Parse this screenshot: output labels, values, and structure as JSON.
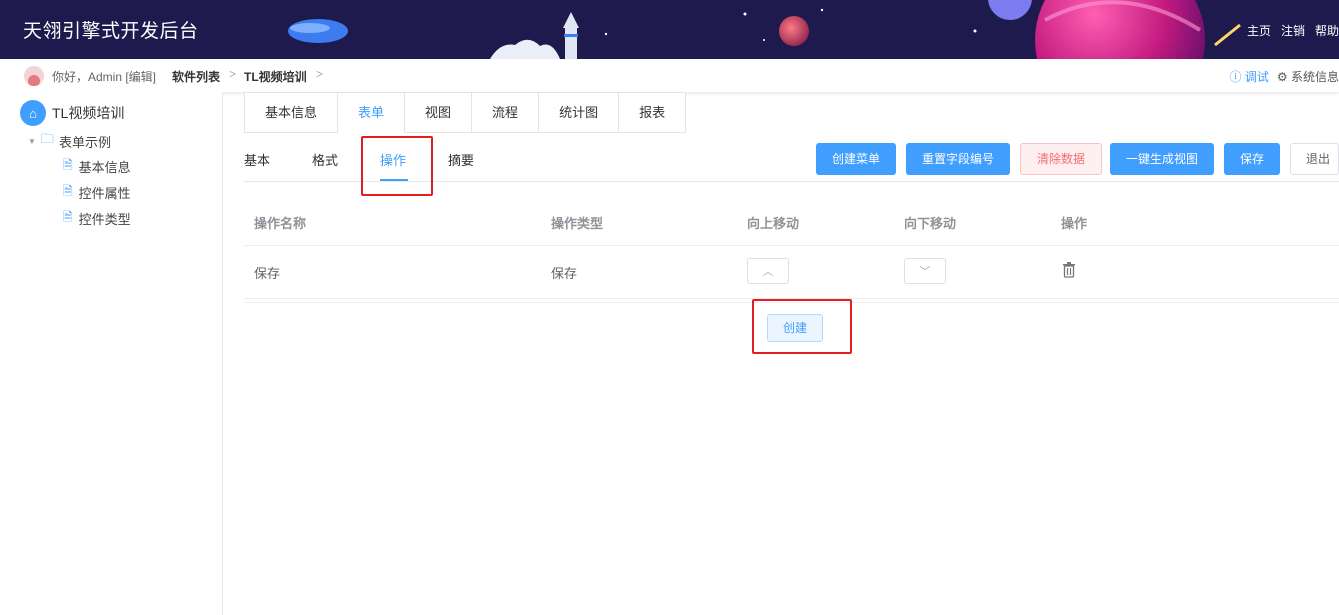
{
  "header": {
    "app_title": "天翎引擎式开发后台",
    "links": [
      "主页",
      "注销",
      "帮助"
    ]
  },
  "breadcrumb": {
    "greeting": "你好，Admin [编辑]",
    "items": [
      "软件列表",
      "TL视频培训"
    ],
    "separator": ">",
    "debug_label": "调试",
    "sysinfo_label": "系统信息"
  },
  "sidebar": {
    "root_label": "TL视频培训",
    "group_label": "表单示例",
    "items": [
      "基本信息",
      "控件属性",
      "控件类型"
    ]
  },
  "tabs": [
    "基本信息",
    "表单",
    "视图",
    "流程",
    "统计图",
    "报表"
  ],
  "active_tab": "表单",
  "subtabs": [
    "基本",
    "格式",
    "操作",
    "摘要"
  ],
  "active_subtab": "操作",
  "toolbar": {
    "create_menu": "创建菜单",
    "reset_field_no": "重置字段编号",
    "clear_data": "清除数据",
    "gen_view": "一键生成视图",
    "save": "保存",
    "exit": "退出"
  },
  "table": {
    "columns": [
      "操作名称",
      "操作类型",
      "向上移动",
      "向下移动",
      "操作"
    ],
    "rows": [
      {
        "name": "保存",
        "type": "保存"
      }
    ]
  },
  "create_button": "创建",
  "colors": {
    "primary": "#409eff",
    "highlight": "#e02020",
    "banner": "#1f1a4e"
  }
}
